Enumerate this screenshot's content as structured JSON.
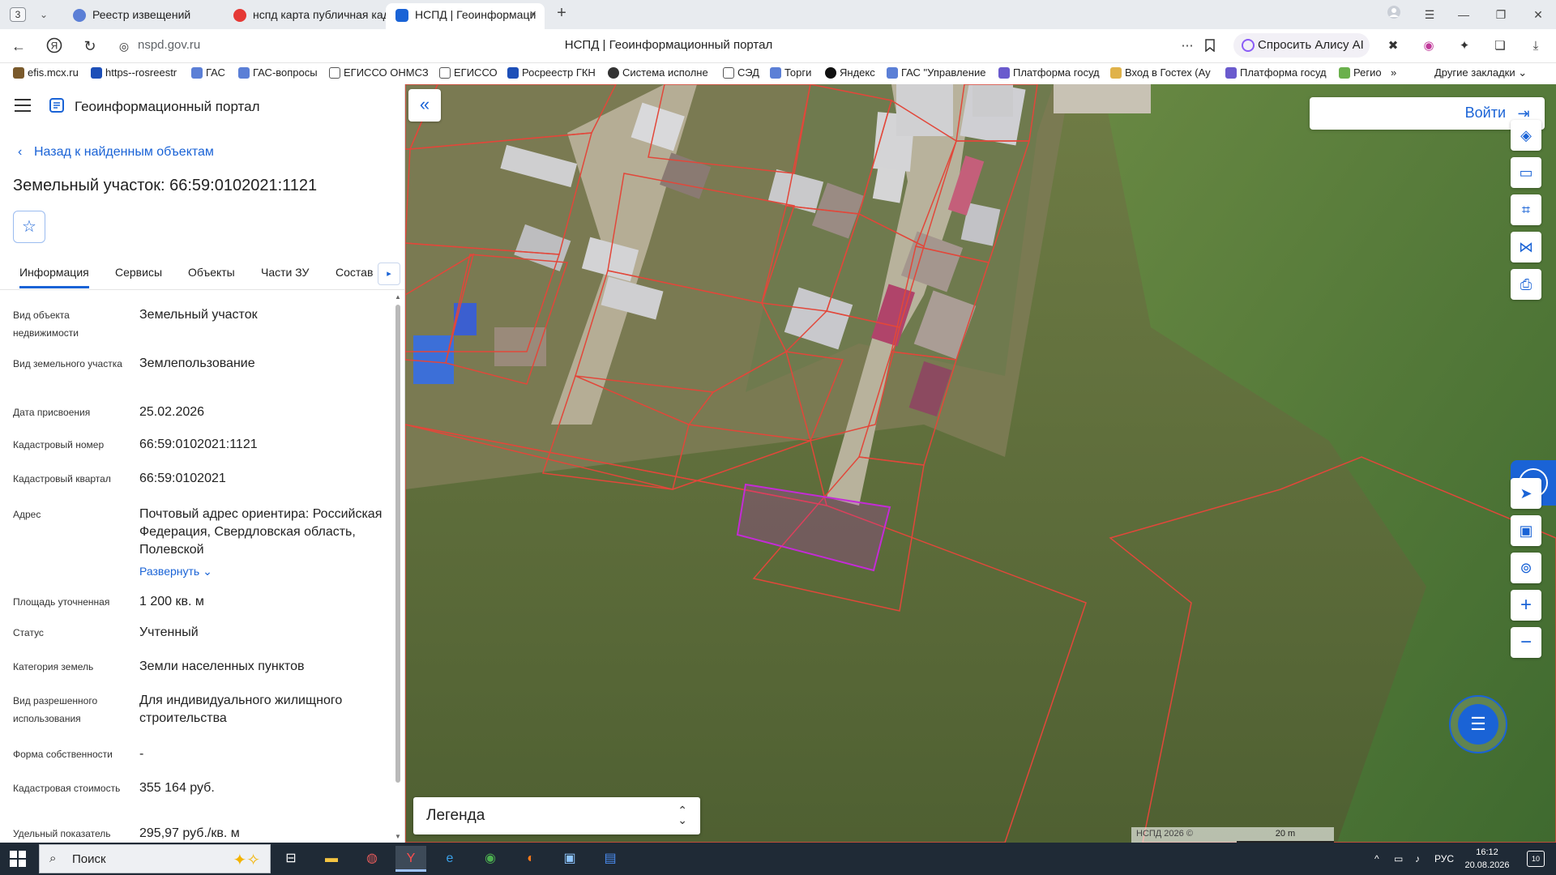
{
  "browser": {
    "tab_counter": "3",
    "tabs": [
      {
        "label": "Реестр извещений",
        "active": false
      },
      {
        "label": "нспд карта публичная кад",
        "active": false
      },
      {
        "label": "НСПД | Геоинформаци",
        "active": true
      }
    ],
    "url_domain": "nspd.gov.ru",
    "page_title": "НСПД | Геоинформационный портал",
    "alice_label": "Спросить Алису AI"
  },
  "bookmarks": [
    "efis.mcx.ru",
    "https--rosreestr",
    "ГАС",
    "ГАС-вопросы",
    "ЕГИССО ОНМСЗ",
    "ЕГИССО",
    "Росреестр ГКН",
    "Система исполне",
    "СЭД",
    "Торги",
    "Яндекс",
    "ГАС \"Управление",
    "Платформа госуд",
    "Вход в Гостех (Ау",
    "Платформа госуд",
    "Регио",
    "»",
    "Другие закладки"
  ],
  "panel": {
    "portal_name": "Геоинформационный портал",
    "back_label": "Назад к найденным объектам",
    "object_title": "Земельный участок: 66:59:0102021:1121",
    "tabs": [
      "Информация",
      "Сервисы",
      "Объекты",
      "Части ЗУ",
      "Состав"
    ],
    "props": [
      {
        "label": "Вид объекта недвижимости",
        "value": "Земельный участок"
      },
      {
        "label": "Вид земельного участка",
        "value": "Землепользование"
      },
      {
        "label": "Дата присвоения",
        "value": "25.02.2026"
      },
      {
        "label": "Кадастровый номер",
        "value": "66:59:0102021:1121"
      },
      {
        "label": "Кадастровый квартал",
        "value": "66:59:0102021"
      },
      {
        "label": "Адрес",
        "value": "Почтовый адрес ориентира: Российская Федерация, Свердловская область, Полевской"
      },
      {
        "label": "Площадь уточненная",
        "value": "1 200 кв. м"
      },
      {
        "label": "Статус",
        "value": "Учтенный"
      },
      {
        "label": "Категория земель",
        "value": "Земли населенных пунктов"
      },
      {
        "label": "Вид разрешенного использования",
        "value": "Для индивидуального жилищного строительства"
      },
      {
        "label": "Форма собственности",
        "value": "-"
      },
      {
        "label": "Кадастровая стоимость",
        "value": "355 164 руб."
      },
      {
        "label": "Удельный показатель",
        "value": "295,97 руб./кв. м"
      }
    ],
    "expand_label": "Развернуть"
  },
  "map": {
    "login_label": "Войти",
    "legend_label": "Легенда",
    "copyright": "НСПД 2026 ©",
    "scale_label": "20 m",
    "parcel_color": "#e2473a",
    "selected_color": "#c42bd6"
  },
  "taskbar": {
    "search_label": "Поиск",
    "lang": "РУС",
    "time": "16:12",
    "date": "20.08.2026",
    "notifications": "10"
  }
}
